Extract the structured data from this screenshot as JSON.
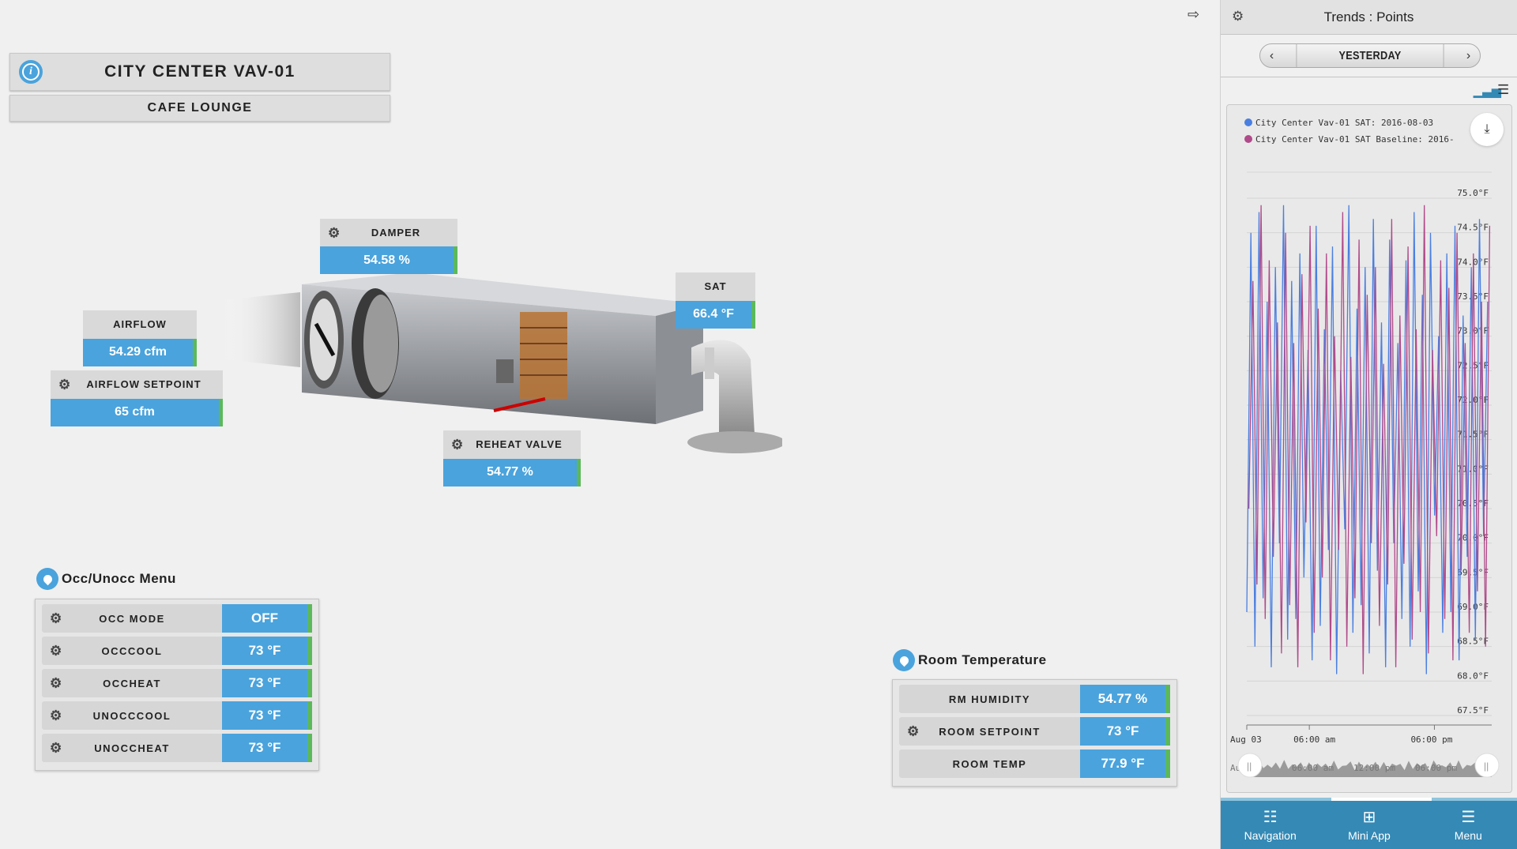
{
  "header": {
    "title": "CITY CENTER VAV-01",
    "subtitle": "CAFE LOUNGE"
  },
  "points": {
    "damper": {
      "label": "DAMPER",
      "value": "54.58 %"
    },
    "sat": {
      "label": "SAT",
      "value": "66.4 °F"
    },
    "airflow": {
      "label": "AIRFLOW",
      "value": "54.29 cfm"
    },
    "airflow_setpoint": {
      "label": "AIRFLOW SETPOINT",
      "value": "65 cfm"
    },
    "reheat_valve": {
      "label": "REHEAT VALVE",
      "value": "54.77 %"
    }
  },
  "occ_menu": {
    "title": "Occ/Unocc Menu",
    "rows": [
      {
        "label": "OCC MODE",
        "value": "OFF"
      },
      {
        "label": "OCCCOOL",
        "value": "73 °F"
      },
      {
        "label": "OCCHEAT",
        "value": "73 °F"
      },
      {
        "label": "UNOCCCOOL",
        "value": "73 °F"
      },
      {
        "label": "UNOCCHEAT",
        "value": "73 °F"
      }
    ]
  },
  "room_temp": {
    "title": "Room Temperature",
    "rows": [
      {
        "label": "RM HUMIDITY",
        "value": "54.77 %",
        "gear": false
      },
      {
        "label": "ROOM SETPOINT",
        "value": "73 °F",
        "gear": true
      },
      {
        "label": "ROOM TEMP",
        "value": "77.9 °F",
        "gear": false
      }
    ]
  },
  "trends": {
    "title": "Trends : Points",
    "range": "YESTERDAY"
  },
  "chart_data": {
    "type": "line",
    "legend": [
      "City Center Vav-01 SAT: 2016-08-03",
      "City Center Vav-01 SAT Baseline: 2016-"
    ],
    "colors": [
      "#4a7fe0",
      "#b04a8a"
    ],
    "ylim": [
      67.5,
      75.0
    ],
    "yticks": [
      "75.0°F",
      "74.5°F",
      "74.0°F",
      "73.5°F",
      "73.0°F",
      "72.5°F",
      "72.0°F",
      "71.5°F",
      "71.0°F",
      "70.5°F",
      "70.0°F",
      "69.5°F",
      "69.0°F",
      "68.5°F",
      "68.0°F",
      "67.5°F"
    ],
    "xlim_hours": [
      0,
      23.5
    ],
    "xticks": [
      {
        "h": 0,
        "label": "Aug 03"
      },
      {
        "h": 6,
        "label": "06:00 am"
      },
      {
        "h": 18,
        "label": "06:00 pm"
      }
    ],
    "navigator_ticks": [
      "Aug 03",
      "06:00 am",
      "12:00 pm",
      "06:00 pm"
    ],
    "grid": true,
    "legend_placement": "top-left",
    "series": [
      {
        "name": "City Center Vav-01 SAT: 2016-08-03",
        "values": [
          69,
          74.5,
          68.5,
          74.8,
          69.2,
          73.5,
          68.2,
          74,
          70,
          74.9,
          68.6,
          73.8,
          68.9,
          74.2,
          69.5,
          72.8,
          68.3,
          74.6,
          68.8,
          73.1,
          69.9,
          74.3,
          68.1,
          72.5,
          70.2,
          74.9,
          68.7,
          73.4,
          69.1,
          74,
          68.4,
          74.7,
          69.6,
          73.2,
          68.2,
          74.4,
          70,
          72.9,
          68.9,
          74.1,
          68.5,
          74.8,
          69.3,
          73.6,
          68.1,
          74.5,
          70.4,
          73,
          68.7,
          74.2,
          69,
          74.6,
          68.3,
          73.3,
          69.8,
          74,
          68.6,
          74.7,
          70.1,
          73.5
        ]
      },
      {
        "name": "City Center Vav-01 SAT Baseline: 2016-",
        "values": [
          70.5,
          73.8,
          69.4,
          74.9,
          68.9,
          74.1,
          69.8,
          73.2,
          68.4,
          74.5,
          69.1,
          72.9,
          68.2,
          73.9,
          70.3,
          74.6,
          68.7,
          73.4,
          69.5,
          74.2,
          68.3,
          73,
          69.9,
          74.8,
          68.5,
          72.7,
          69.2,
          74.4,
          68.1,
          73.6,
          70,
          74,
          68.8,
          72.6,
          69.4,
          74.7,
          68.2,
          73.3,
          69.7,
          74.3,
          68.6,
          73.1,
          69,
          74.9,
          68.4,
          72.8,
          70.1,
          74.1,
          68.9,
          73.7,
          68.3,
          74.5,
          69.6,
          72.9,
          68.7,
          74.2,
          69.3,
          73.5,
          68.5,
          74.6
        ]
      }
    ]
  },
  "bottom_nav": [
    {
      "label": "Navigation",
      "icon": "list-icon"
    },
    {
      "label": "Mini App",
      "icon": "grid-icon"
    },
    {
      "label": "Menu",
      "icon": "hamburger-icon"
    }
  ]
}
